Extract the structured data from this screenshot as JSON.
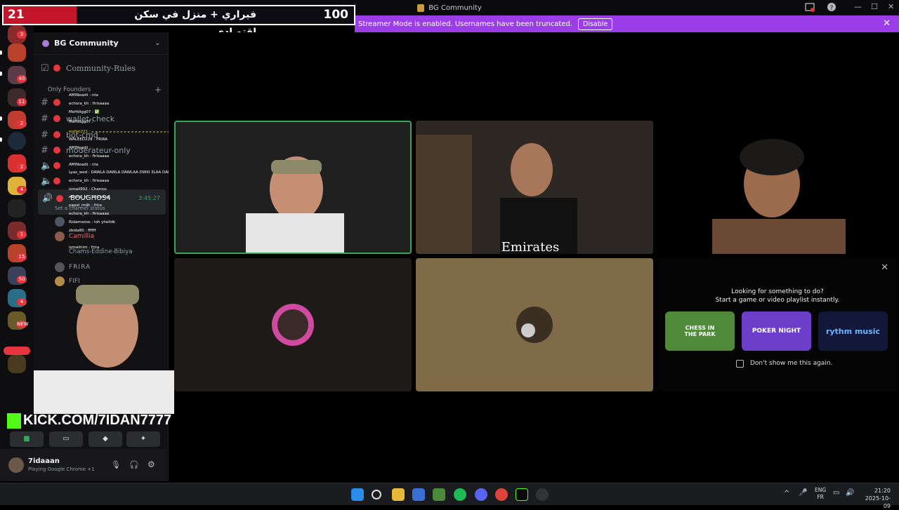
{
  "window": {
    "title": "BG Community"
  },
  "overlay": {
    "left_number": "21",
    "arabic_title": "فيراري + منزل في سكن اقتصادي",
    "right_number": "100",
    "kick_url": "KICK.COM/7IDAN7777"
  },
  "streamer_mode": {
    "message": "Streamer Mode is enabled. Usernames have been truncated.",
    "button": "Disable"
  },
  "server": {
    "name": "BG Community"
  },
  "channels": {
    "community_rules": "Community-Rules",
    "category": "Only Founders",
    "wallet": "wallet-check",
    "bot": "bot-cmd",
    "moderateur": "moderateur-only",
    "voice_stage_name": "BOUGHOS4",
    "voice_stage_time": "3:45:27",
    "voice_status": "Set a channel status",
    "members": [
      "Camillia",
      "Chams-Eddine-Bibiya",
      "FRIRA",
      "FIFI"
    ]
  },
  "chat_overlay": [
    "AMINeadii : nta",
    "echora_kh : firisaaaa",
    "MeHdigg07 : ✅",
    "MeHdigg07 :",
    "wallet221 : ﺟ ﺟ ﺟ ﺟ ﺟ ﺟ ﺟ ﺟ ﺟ ﺟ ﺟ ﺟ ﺟ ﺟ ﺟ ﺟ ﺟ ﺟ ﺟ ﺟ ﺟ ﺟ ﺟ ﺟ ﺟ ﺟ ﺟ ﺟ ﺟ ﺟ ﺟ ﺟ ﺟ ﺟ ﺟ ﺟ",
    "WALEED228 : FRIRA",
    "AMINeadii :",
    "echora_kh : firisaaaa",
    "AMINeadii : nta",
    "Lyas_wed : DAWLA DAWLA DAWLAA DWIII 3LAA DAWLAAAA LHOUKOMAA",
    "echora_kh : firisaaaa",
    "ismail992 : Chamss",
    "echora_kh : firisaaaa",
    "papel_mdh : frira",
    "echora_kh : firisaaaa",
    "Ridamsone : loh yhelldk",
    "zbida80 : ffffff",
    "ismailnim : frira"
  ],
  "user": {
    "name": "7idaaan",
    "status": "Playing Google Chrome +1"
  },
  "voice_controls": [
    "camera",
    "screen-share",
    "activity",
    "soundboard"
  ],
  "activity_popup": {
    "heading": "Looking for something to do?",
    "subheading": "Start a game or video playlist instantly.",
    "cards": [
      "CHESS IN THE PARK",
      "POKER NIGHT",
      "rythm music"
    ],
    "checkbox_label": "Don't show me this again."
  },
  "guild_badges": [
    "3",
    "40",
    "11",
    "2",
    "2",
    "4",
    "1",
    "15",
    "50",
    "4",
    "NEW"
  ],
  "taskbar": {
    "lang_top": "ENG",
    "lang_bottom": "FR",
    "time": "21:20",
    "date": "2025-10-09"
  },
  "colors": {
    "streamer_purple": "#9b3ee8",
    "overlay_red": "#c3162a",
    "kick_green": "#53fc18",
    "discord_red": "#e5353f",
    "active_green": "#3ba55d"
  }
}
